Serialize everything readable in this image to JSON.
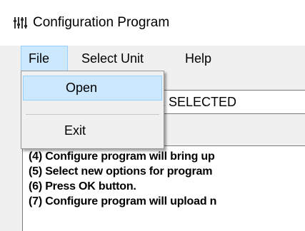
{
  "window": {
    "title": "Configuration Program",
    "icon": "app-configuration-icon"
  },
  "menubar": {
    "items": [
      {
        "label": "File",
        "active": true
      },
      {
        "label": "Select Unit",
        "active": false
      },
      {
        "label": "Help",
        "active": false
      }
    ]
  },
  "file_menu": {
    "items": [
      {
        "label": "Open",
        "highlighted": true
      },
      {
        "label": "Exit",
        "highlighted": false
      }
    ]
  },
  "selected_field": {
    "value": "E SELECTED"
  },
  "instructions": [
    "(4) Configure program will bring up",
    "(5) Select new options for program",
    "(6) Press OK button.",
    "(7) Configure program will upload n"
  ],
  "colors": {
    "menu_highlight": "#cce8ff",
    "menu_highlight_border": "#99d1ff",
    "window_bg": "#f0f0f0"
  }
}
